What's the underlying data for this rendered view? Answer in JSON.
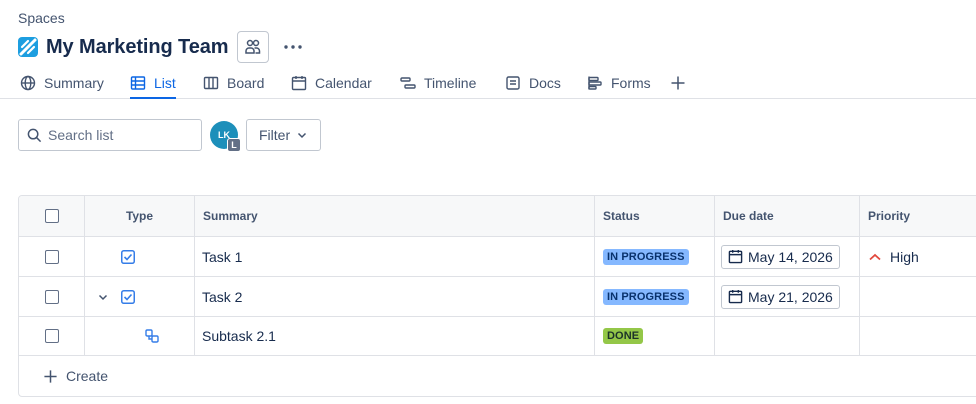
{
  "breadcrumb": "Spaces",
  "space": {
    "title": "My Marketing Team",
    "icon": "space-logo-icon"
  },
  "tabs": [
    {
      "label": "Summary",
      "icon": "globe-icon",
      "active": false
    },
    {
      "label": "List",
      "icon": "list-icon",
      "active": true
    },
    {
      "label": "Board",
      "icon": "board-icon",
      "active": false
    },
    {
      "label": "Calendar",
      "icon": "calendar-icon",
      "active": false
    },
    {
      "label": "Timeline",
      "icon": "timeline-icon",
      "active": false
    },
    {
      "label": "Docs",
      "icon": "docs-icon",
      "active": false
    },
    {
      "label": "Forms",
      "icon": "forms-icon",
      "active": false
    }
  ],
  "toolbar": {
    "search_placeholder": "Search list",
    "avatar_initials": "LK",
    "avatar_badge": "L",
    "filter_label": "Filter"
  },
  "table": {
    "columns": [
      "Type",
      "Summary",
      "Status",
      "Due date",
      "Priority"
    ],
    "rows": [
      {
        "summary": "Task 1",
        "type": "task-icon",
        "status": "IN PROGRESS",
        "due": "May 14, 2026",
        "priority": "High",
        "expandable": false
      },
      {
        "summary": "Task 2",
        "type": "task-icon",
        "status": "IN PROGRESS",
        "due": "May 21, 2026",
        "priority": "",
        "expandable": true
      },
      {
        "summary": "Subtask 2.1",
        "type": "subtask-icon",
        "status": "DONE",
        "due": "",
        "priority": ""
      }
    ],
    "create_label": "Create"
  },
  "colors": {
    "accent": "#0c66e4",
    "in_progress_bg": "#85b8ff",
    "done_bg": "#94c748",
    "priority_high": "#e2483d"
  }
}
